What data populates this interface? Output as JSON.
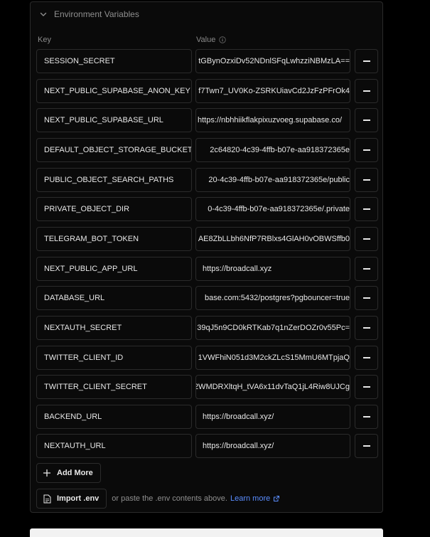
{
  "section": {
    "title": "Environment Variables",
    "columns": {
      "key": "Key",
      "value": "Value"
    }
  },
  "rows": [
    {
      "key": "SESSION_SECRET",
      "value": "tGBynOzxiDv52NDnlSFqLwhzziNBMzLA==",
      "display": "clip"
    },
    {
      "key": "NEXT_PUBLIC_SUPABASE_ANON_KEY",
      "value": "f7Twn7_UV0Ko-ZSRKUiavCd2JzFzPFrOk4",
      "display": "clip"
    },
    {
      "key": "NEXT_PUBLIC_SUPABASE_URL",
      "value": "https://nbhhiikflakpixuzvoeg.supabase.co/",
      "display": "plain-tight"
    },
    {
      "key": "DEFAULT_OBJECT_STORAGE_BUCKET",
      "value": "2c64820-4c39-4ffb-b07e-aa918372365e",
      "display": "clip"
    },
    {
      "key": "PUBLIC_OBJECT_SEARCH_PATHS",
      "value": "20-4c39-4ffb-b07e-aa918372365e/public",
      "display": "clip"
    },
    {
      "key": "PRIVATE_OBJECT_DIR",
      "value": "0-4c39-4ffb-b07e-aa918372365e/.private",
      "display": "clip"
    },
    {
      "key": "TELEGRAM_BOT_TOKEN",
      "value": "AE8ZbLLbh6NfP7RBlxs4GlAH0vOBWSffb0",
      "display": "clip"
    },
    {
      "key": "NEXT_PUBLIC_APP_URL",
      "value": "https://broadcall.xyz",
      "display": "plain"
    },
    {
      "key": "DATABASE_URL",
      "value": "base.com:5432/postgres?pgbouncer=true",
      "display": "clip"
    },
    {
      "key": "NEXTAUTH_SECRET",
      "value": "39qJ5n9CD0kRTKab7q1nZerDOZr0v55Pc=",
      "display": "clip"
    },
    {
      "key": "TWITTER_CLIENT_ID",
      "value": "1VWFhiN051d3M2ckZLcS15MmU6MTpjaQ",
      "display": "clip"
    },
    {
      "key": "TWITTER_CLIENT_SECRET",
      "value": "2WMDRXltqH_tVA6x11dvTaQ1jL4Riw8UJCg",
      "display": "clip"
    },
    {
      "key": "BACKEND_URL",
      "value": "https://broadcall.xyz/",
      "display": "plain"
    },
    {
      "key": "NEXTAUTH_URL",
      "value": "https://broadcall.xyz/",
      "display": "plain"
    }
  ],
  "actions": {
    "add_more": "Add More",
    "import_env": "Import .env",
    "import_hint": "or paste the .env contents above.",
    "learn_more": "Learn more"
  },
  "icons": {
    "header": "chevron-down-icon",
    "value_info": "info-icon",
    "remove": "minus-icon",
    "add": "plus-icon",
    "import": "file-icon",
    "learn_more": "external-link-icon"
  },
  "colors": {
    "background": "#000000",
    "panel": "#0a0a0a",
    "border": "#2b2b2b",
    "text": "#e8e8e8",
    "muted": "#8f8f8f",
    "link": "#5a8dff"
  }
}
